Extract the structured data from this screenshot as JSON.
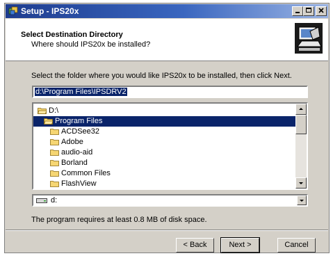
{
  "window": {
    "title": "Setup - IPS20x"
  },
  "header": {
    "title": "Select Destination Directory",
    "subtitle": "Where should IPS20x be installed?",
    "icon": "computer-install-icon"
  },
  "body": {
    "instruction": "Select the folder where you would like IPS20x to be installed, then click Next.",
    "path_value": "d:\\Program Files\\IPSDRV2",
    "folders": [
      {
        "label": "D:\\",
        "icon": "open-folder-icon",
        "selected": false,
        "indent": 0
      },
      {
        "label": "Program Files",
        "icon": "open-folder-icon",
        "selected": true,
        "indent": 1
      },
      {
        "label": "ACDSee32",
        "icon": "folder-icon",
        "selected": false,
        "indent": 2
      },
      {
        "label": "Adobe",
        "icon": "folder-icon",
        "selected": false,
        "indent": 2
      },
      {
        "label": "audio-aid",
        "icon": "folder-icon",
        "selected": false,
        "indent": 2
      },
      {
        "label": "Borland",
        "icon": "folder-icon",
        "selected": false,
        "indent": 2
      },
      {
        "label": "Common Files",
        "icon": "folder-icon",
        "selected": false,
        "indent": 2
      },
      {
        "label": "FlashView",
        "icon": "folder-icon",
        "selected": false,
        "indent": 2
      }
    ],
    "drive_value": "d:",
    "disk_note": "The program requires at least 0.8 MB of disk space."
  },
  "buttons": {
    "back": "< Back",
    "next": "Next >",
    "cancel": "Cancel"
  },
  "colors": {
    "selection": "#0a246a",
    "face": "#d4d0c8",
    "title_start": "#1d3c8f"
  }
}
